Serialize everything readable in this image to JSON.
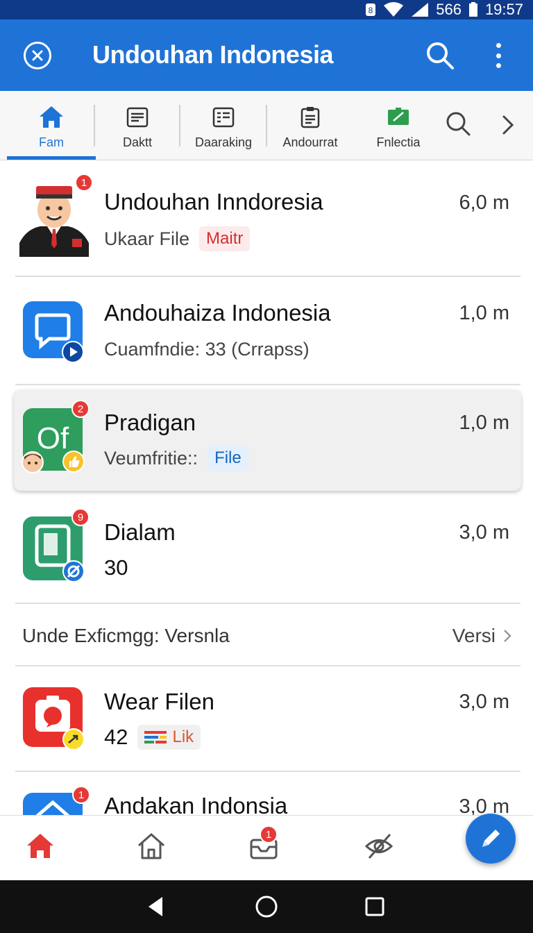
{
  "status_bar": {
    "signal_text": "566",
    "time": "19:57"
  },
  "app_bar": {
    "title": "Undouhan Indonesia"
  },
  "tabs": [
    {
      "label": "Fam",
      "icon": "home-icon"
    },
    {
      "label": "Daktt",
      "icon": "list-icon"
    },
    {
      "label": "Daaraking",
      "icon": "list-icon"
    },
    {
      "label": "Andourrat",
      "icon": "clipboard-icon"
    },
    {
      "label": "Fnlectia",
      "icon": "flag-icon"
    }
  ],
  "items": [
    {
      "title": "Undouhan Inndoresia",
      "subtitle": "Ukaar File",
      "chip": "Maitr",
      "size": "6,0 m",
      "badge": "1"
    },
    {
      "title": "Andouhaiza Indonesia",
      "subtitle": "Cuamfndie: 33 (Crrapss)",
      "size": "1,0 m"
    },
    {
      "title": "Pradigan",
      "subtitle": "Veumfritie::",
      "chip": "File",
      "size": "1,0 m",
      "badge": "2"
    },
    {
      "title": "Dialam",
      "subtitle": "30",
      "size": "3,0 m",
      "badge": "9"
    },
    {
      "title": "Wear Filen",
      "subtitle": "42",
      "chip": "Lik",
      "size": "3,0 m"
    },
    {
      "title": "Andakan Indonsia",
      "size": "3,0 m",
      "badge": "1"
    }
  ],
  "section": {
    "label": "Unde Exficmgg: Versnla",
    "link": "Versi"
  },
  "bottom_nav": {
    "messages_badge": "1"
  },
  "colors": {
    "primary": "#1f73d6",
    "badge": "#e53935",
    "status_bar": "#0f3a8a"
  }
}
